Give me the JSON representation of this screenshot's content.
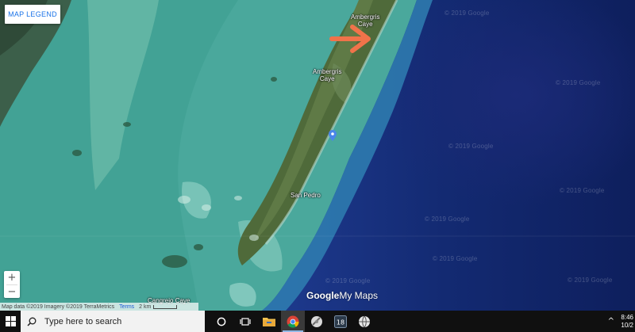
{
  "map": {
    "legend_button": "MAP LEGEND",
    "places": {
      "ambergris_caye_top": "Ambergris\nCaye",
      "ambergris_caye_mid": "Ambergris\nCaye",
      "san_pedro": "San Pedro",
      "cangrejo_caye": "Cangrejo Caye"
    },
    "watermarks": [
      "© 2019 Google",
      "© 2019 Google",
      "© 2019 Google",
      "© 2019 Google",
      "© 2019 Google",
      "© 2019 Google",
      "© 2019 Google",
      "© 2019 Google"
    ],
    "zoom": {
      "in": "+",
      "out": "−"
    },
    "brand": {
      "google": "Google",
      "my_maps": "My Maps"
    },
    "attribution": {
      "data": "Map data ©2019 Imagery ©2019 TerraMetrics",
      "terms": "Terms",
      "scale": "2 km"
    },
    "annotation_arrow_color": "#f0734a",
    "marker_color": "#4a86e8"
  },
  "taskbar": {
    "search_placeholder": "Type here to search",
    "icons": [
      "windows-icon",
      "cortana-icon",
      "task-view-icon",
      "file-explorer-icon",
      "chrome-icon",
      "app-icon",
      "app-18-icon",
      "app-globe-icon"
    ],
    "tray": {
      "chevron": "^",
      "time": "8:46",
      "date": "10/2"
    }
  }
}
